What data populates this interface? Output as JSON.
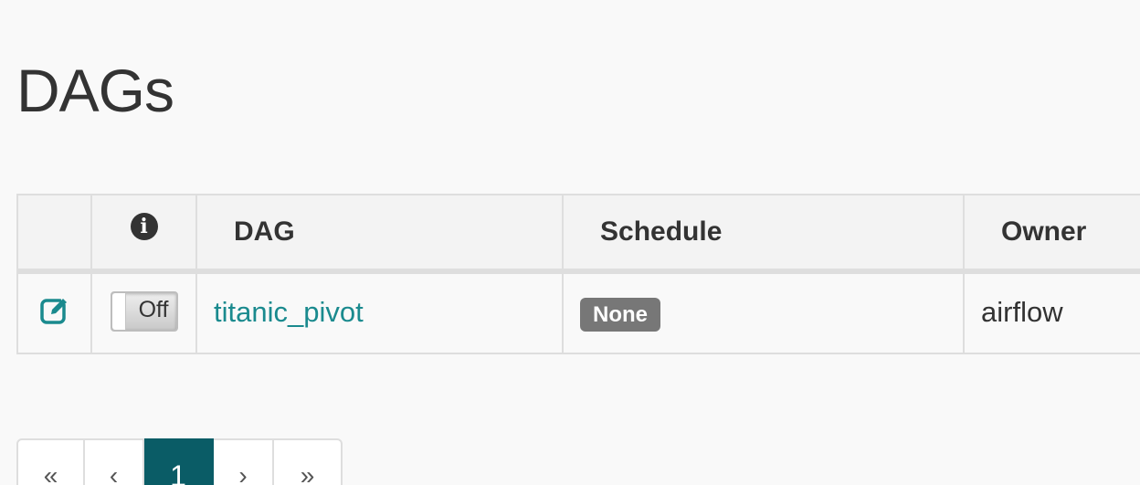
{
  "page": {
    "title": "DAGs"
  },
  "table": {
    "headers": {
      "edit": "",
      "info_icon": "info-circle-icon",
      "dag": "DAG",
      "schedule": "Schedule",
      "owner": "Owner"
    },
    "rows": [
      {
        "edit_icon": "edit-icon",
        "toggle": "Off",
        "dag": "titanic_pivot",
        "schedule": "None",
        "owner": "airflow"
      }
    ]
  },
  "pagination": {
    "first": "«",
    "prev": "‹",
    "current": "1",
    "next": "›",
    "last": "»"
  },
  "colors": {
    "accent": "#1a8a8e",
    "active_page": "#0a5c66",
    "badge": "#777777"
  }
}
